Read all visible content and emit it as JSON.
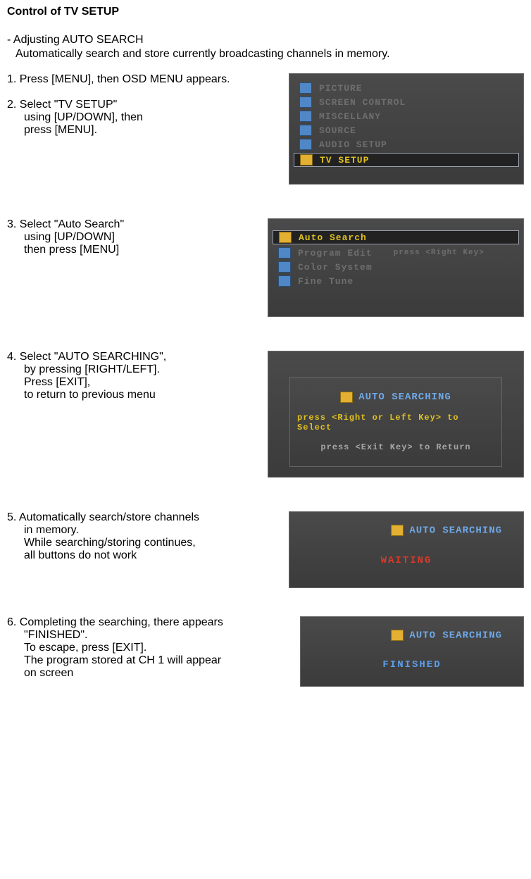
{
  "title": "Control of TV SETUP",
  "intro": {
    "line1": "- Adjusting AUTO SEARCH",
    "line2": "Automatically search and store currently broadcasting channels in memory."
  },
  "steps": {
    "s1": {
      "line1": "1. Press [MENU], then OSD MENU appears."
    },
    "s2": {
      "line1": "2. Select \"TV SETUP\"",
      "line2": "using [UP/DOWN], then",
      "line3": "press  [MENU]."
    },
    "s3": {
      "line1": "3. Select \"Auto Search\"",
      "line2": "using [UP/DOWN]",
      "line3": "then press  [MENU]"
    },
    "s4": {
      "line1": "4. Select \"AUTO SEARCHING\",",
      "line2": "by pressing [RIGHT/LEFT].",
      "line3": "Press [EXIT],",
      "line4": "to return to previous menu"
    },
    "s5": {
      "line1": "5. Automatically search/store channels",
      "line2": "in memory.",
      "line3": "While searching/storing continues,",
      "line4": "all buttons do not work"
    },
    "s6": {
      "line1": "6. Completing the searching, there appears",
      "line2": "\"FINISHED\".",
      "line3": "To escape, press [EXIT].",
      "line4": "The program stored at CH 1 will appear",
      "line5": "on screen"
    }
  },
  "osd1": {
    "items": [
      "PICTURE",
      "SCREEN CONTROL",
      "MISCELLANY",
      "SOURCE",
      "AUDIO SETUP",
      "TV SETUP"
    ],
    "selected_index": 5
  },
  "osd2": {
    "items": [
      {
        "label": "Auto Search",
        "hint": ""
      },
      {
        "label": "Program Edit",
        "hint": "press <Right Key>"
      },
      {
        "label": "Color System",
        "hint": ""
      },
      {
        "label": "Fine Tune",
        "hint": ""
      }
    ],
    "selected_index": 0
  },
  "osd3": {
    "title": "AUTO SEARCHING",
    "line1": "press <Right or Left Key> to Select",
    "line2": "press <Exit Key> to Return"
  },
  "osd4": {
    "title": "AUTO SEARCHING",
    "status": "WAITING"
  },
  "osd5": {
    "title": "AUTO SEARCHING",
    "status": "FINISHED"
  }
}
